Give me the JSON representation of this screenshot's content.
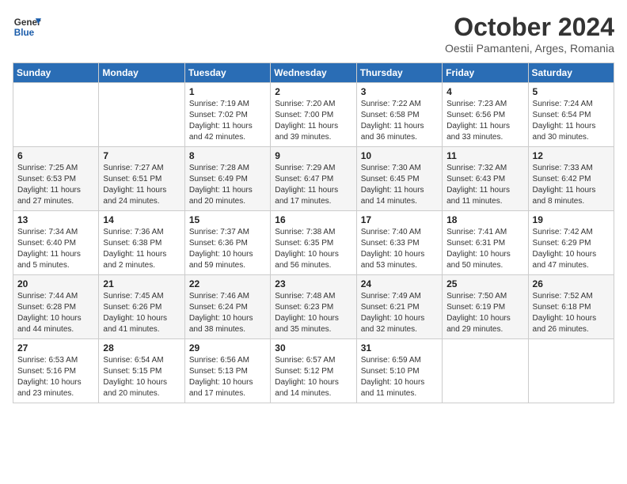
{
  "header": {
    "logo_line1": "General",
    "logo_line2": "Blue",
    "month": "October 2024",
    "location": "Oestii Pamanteni, Arges, Romania"
  },
  "weekdays": [
    "Sunday",
    "Monday",
    "Tuesday",
    "Wednesday",
    "Thursday",
    "Friday",
    "Saturday"
  ],
  "weeks": [
    [
      {
        "day": "",
        "info": ""
      },
      {
        "day": "",
        "info": ""
      },
      {
        "day": "1",
        "info": "Sunrise: 7:19 AM\nSunset: 7:02 PM\nDaylight: 11 hours and 42 minutes."
      },
      {
        "day": "2",
        "info": "Sunrise: 7:20 AM\nSunset: 7:00 PM\nDaylight: 11 hours and 39 minutes."
      },
      {
        "day": "3",
        "info": "Sunrise: 7:22 AM\nSunset: 6:58 PM\nDaylight: 11 hours and 36 minutes."
      },
      {
        "day": "4",
        "info": "Sunrise: 7:23 AM\nSunset: 6:56 PM\nDaylight: 11 hours and 33 minutes."
      },
      {
        "day": "5",
        "info": "Sunrise: 7:24 AM\nSunset: 6:54 PM\nDaylight: 11 hours and 30 minutes."
      }
    ],
    [
      {
        "day": "6",
        "info": "Sunrise: 7:25 AM\nSunset: 6:53 PM\nDaylight: 11 hours and 27 minutes."
      },
      {
        "day": "7",
        "info": "Sunrise: 7:27 AM\nSunset: 6:51 PM\nDaylight: 11 hours and 24 minutes."
      },
      {
        "day": "8",
        "info": "Sunrise: 7:28 AM\nSunset: 6:49 PM\nDaylight: 11 hours and 20 minutes."
      },
      {
        "day": "9",
        "info": "Sunrise: 7:29 AM\nSunset: 6:47 PM\nDaylight: 11 hours and 17 minutes."
      },
      {
        "day": "10",
        "info": "Sunrise: 7:30 AM\nSunset: 6:45 PM\nDaylight: 11 hours and 14 minutes."
      },
      {
        "day": "11",
        "info": "Sunrise: 7:32 AM\nSunset: 6:43 PM\nDaylight: 11 hours and 11 minutes."
      },
      {
        "day": "12",
        "info": "Sunrise: 7:33 AM\nSunset: 6:42 PM\nDaylight: 11 hours and 8 minutes."
      }
    ],
    [
      {
        "day": "13",
        "info": "Sunrise: 7:34 AM\nSunset: 6:40 PM\nDaylight: 11 hours and 5 minutes."
      },
      {
        "day": "14",
        "info": "Sunrise: 7:36 AM\nSunset: 6:38 PM\nDaylight: 11 hours and 2 minutes."
      },
      {
        "day": "15",
        "info": "Sunrise: 7:37 AM\nSunset: 6:36 PM\nDaylight: 10 hours and 59 minutes."
      },
      {
        "day": "16",
        "info": "Sunrise: 7:38 AM\nSunset: 6:35 PM\nDaylight: 10 hours and 56 minutes."
      },
      {
        "day": "17",
        "info": "Sunrise: 7:40 AM\nSunset: 6:33 PM\nDaylight: 10 hours and 53 minutes."
      },
      {
        "day": "18",
        "info": "Sunrise: 7:41 AM\nSunset: 6:31 PM\nDaylight: 10 hours and 50 minutes."
      },
      {
        "day": "19",
        "info": "Sunrise: 7:42 AM\nSunset: 6:29 PM\nDaylight: 10 hours and 47 minutes."
      }
    ],
    [
      {
        "day": "20",
        "info": "Sunrise: 7:44 AM\nSunset: 6:28 PM\nDaylight: 10 hours and 44 minutes."
      },
      {
        "day": "21",
        "info": "Sunrise: 7:45 AM\nSunset: 6:26 PM\nDaylight: 10 hours and 41 minutes."
      },
      {
        "day": "22",
        "info": "Sunrise: 7:46 AM\nSunset: 6:24 PM\nDaylight: 10 hours and 38 minutes."
      },
      {
        "day": "23",
        "info": "Sunrise: 7:48 AM\nSunset: 6:23 PM\nDaylight: 10 hours and 35 minutes."
      },
      {
        "day": "24",
        "info": "Sunrise: 7:49 AM\nSunset: 6:21 PM\nDaylight: 10 hours and 32 minutes."
      },
      {
        "day": "25",
        "info": "Sunrise: 7:50 AM\nSunset: 6:19 PM\nDaylight: 10 hours and 29 minutes."
      },
      {
        "day": "26",
        "info": "Sunrise: 7:52 AM\nSunset: 6:18 PM\nDaylight: 10 hours and 26 minutes."
      }
    ],
    [
      {
        "day": "27",
        "info": "Sunrise: 6:53 AM\nSunset: 5:16 PM\nDaylight: 10 hours and 23 minutes."
      },
      {
        "day": "28",
        "info": "Sunrise: 6:54 AM\nSunset: 5:15 PM\nDaylight: 10 hours and 20 minutes."
      },
      {
        "day": "29",
        "info": "Sunrise: 6:56 AM\nSunset: 5:13 PM\nDaylight: 10 hours and 17 minutes."
      },
      {
        "day": "30",
        "info": "Sunrise: 6:57 AM\nSunset: 5:12 PM\nDaylight: 10 hours and 14 minutes."
      },
      {
        "day": "31",
        "info": "Sunrise: 6:59 AM\nSunset: 5:10 PM\nDaylight: 10 hours and 11 minutes."
      },
      {
        "day": "",
        "info": ""
      },
      {
        "day": "",
        "info": ""
      }
    ]
  ]
}
